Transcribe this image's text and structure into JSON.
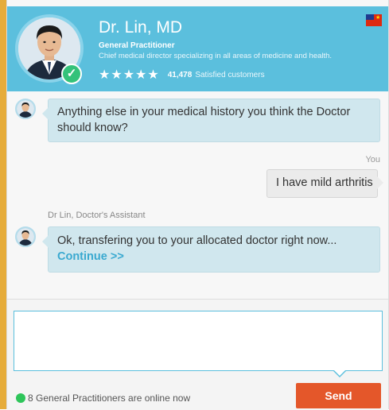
{
  "colors": {
    "header_bg": "#5bbfdd",
    "bubble_doctor": "#d0e7ee",
    "bubble_user": "#ebebeb",
    "send": "#e4572a",
    "online": "#2ec55a",
    "link": "#3aa9d0"
  },
  "doctor": {
    "name": "Dr. Lin, MD",
    "title": "General Practitioner",
    "description": "Chief medical director specializing in all areas of medicine and health.",
    "stars": "★★★★★",
    "rating": 5,
    "customers_count": "41,478",
    "customers_label": "Satisfied customers",
    "verified_icon": "check-icon",
    "flag_icon": "australia-china-flag-icon"
  },
  "messages": [
    {
      "from": "doctor",
      "text": "Anything else in your medical history you think the Doctor should know?"
    },
    {
      "from": "user",
      "sender_label": "You",
      "text": "I have mild arthritis"
    },
    {
      "from": "assistant",
      "sender_label": "Dr Lin, Doctor's Assistant",
      "text": "Ok, transfering you to your allocated doctor right now...",
      "link": "Continue >>"
    }
  ],
  "composer": {
    "value": "",
    "placeholder": "",
    "send_label": "Send"
  },
  "status": {
    "online_text": "8 General Practitioners are online now"
  }
}
